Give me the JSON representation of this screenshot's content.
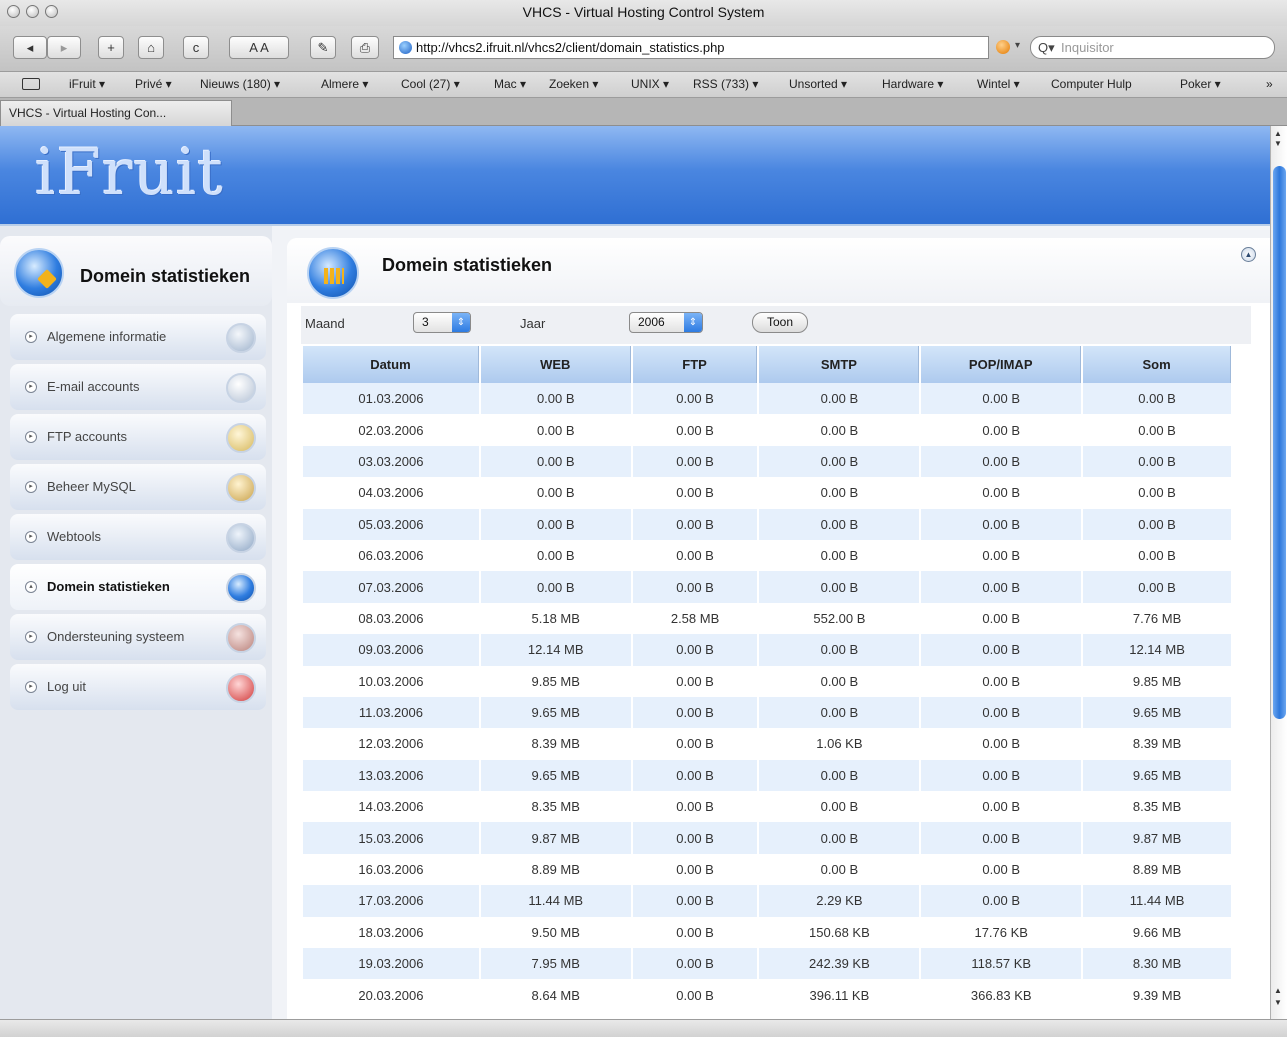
{
  "window": {
    "title": "VHCS - Virtual Hosting Control System"
  },
  "toolbar": {
    "back_label": "◂",
    "forward_label": "▸",
    "add_label": "+",
    "home_label": "⌂",
    "reload_label": "c",
    "text_size_label": "A A",
    "print_label": "⎙",
    "url": "http://vhcs2.ifruit.nl/vhcs2/client/domain_statistics.php",
    "search_placeholder": "Inquisitor"
  },
  "bookmarks": [
    "iFruit ▾",
    "Privé ▾",
    "Nieuws (180) ▾",
    "Almere ▾",
    "Cool (27) ▾",
    "Mac ▾",
    "Zoeken ▾",
    "UNIX ▾",
    "RSS (733) ▾",
    "Unsorted ▾",
    "Hardware ▾",
    "Wintel ▾",
    "Computer Hulp",
    "Poker ▾",
    "»"
  ],
  "tab": {
    "label": "VHCS - Virtual Hosting Con..."
  },
  "banner": {
    "logo_text": "iFruit"
  },
  "sidebar": {
    "title": "Domein statistieken",
    "items": [
      {
        "label": "Algemene informatie",
        "icon": "info-icon"
      },
      {
        "label": "E-mail accounts",
        "icon": "mail-icon"
      },
      {
        "label": "FTP accounts",
        "icon": "folder-icon"
      },
      {
        "label": "Beheer MySQL",
        "icon": "database-icon"
      },
      {
        "label": "Webtools",
        "icon": "tools-icon"
      },
      {
        "label": "Domein statistieken",
        "icon": "statistics-icon",
        "active": true
      },
      {
        "label": "Ondersteuning systeem",
        "icon": "support-icon"
      },
      {
        "label": "Log uit",
        "icon": "logout-icon"
      }
    ]
  },
  "main": {
    "title": "Domein statistieken",
    "filter": {
      "month_label": "Maand",
      "month_value": "3",
      "year_label": "Jaar",
      "year_value": "2006",
      "submit_label": "Toon"
    },
    "table": {
      "headers": [
        "Datum",
        "WEB",
        "FTP",
        "SMTP",
        "POP/IMAP",
        "Som"
      ],
      "rows": [
        [
          "01.03.2006",
          "0.00 B",
          "0.00 B",
          "0.00 B",
          "0.00 B",
          "0.00 B"
        ],
        [
          "02.03.2006",
          "0.00 B",
          "0.00 B",
          "0.00 B",
          "0.00 B",
          "0.00 B"
        ],
        [
          "03.03.2006",
          "0.00 B",
          "0.00 B",
          "0.00 B",
          "0.00 B",
          "0.00 B"
        ],
        [
          "04.03.2006",
          "0.00 B",
          "0.00 B",
          "0.00 B",
          "0.00 B",
          "0.00 B"
        ],
        [
          "05.03.2006",
          "0.00 B",
          "0.00 B",
          "0.00 B",
          "0.00 B",
          "0.00 B"
        ],
        [
          "06.03.2006",
          "0.00 B",
          "0.00 B",
          "0.00 B",
          "0.00 B",
          "0.00 B"
        ],
        [
          "07.03.2006",
          "0.00 B",
          "0.00 B",
          "0.00 B",
          "0.00 B",
          "0.00 B"
        ],
        [
          "08.03.2006",
          "5.18 MB",
          "2.58 MB",
          "552.00 B",
          "0.00 B",
          "7.76 MB"
        ],
        [
          "09.03.2006",
          "12.14 MB",
          "0.00 B",
          "0.00 B",
          "0.00 B",
          "12.14 MB"
        ],
        [
          "10.03.2006",
          "9.85 MB",
          "0.00 B",
          "0.00 B",
          "0.00 B",
          "9.85 MB"
        ],
        [
          "11.03.2006",
          "9.65 MB",
          "0.00 B",
          "0.00 B",
          "0.00 B",
          "9.65 MB"
        ],
        [
          "12.03.2006",
          "8.39 MB",
          "0.00 B",
          "1.06 KB",
          "0.00 B",
          "8.39 MB"
        ],
        [
          "13.03.2006",
          "9.65 MB",
          "0.00 B",
          "0.00 B",
          "0.00 B",
          "9.65 MB"
        ],
        [
          "14.03.2006",
          "8.35 MB",
          "0.00 B",
          "0.00 B",
          "0.00 B",
          "8.35 MB"
        ],
        [
          "15.03.2006",
          "9.87 MB",
          "0.00 B",
          "0.00 B",
          "0.00 B",
          "9.87 MB"
        ],
        [
          "16.03.2006",
          "8.89 MB",
          "0.00 B",
          "0.00 B",
          "0.00 B",
          "8.89 MB"
        ],
        [
          "17.03.2006",
          "11.44 MB",
          "0.00 B",
          "2.29 KB",
          "0.00 B",
          "11.44 MB"
        ],
        [
          "18.03.2006",
          "9.50 MB",
          "0.00 B",
          "150.68 KB",
          "17.76 KB",
          "9.66 MB"
        ],
        [
          "19.03.2006",
          "7.95 MB",
          "0.00 B",
          "242.39 KB",
          "118.57 KB",
          "8.30 MB"
        ],
        [
          "20.03.2006",
          "8.64 MB",
          "0.00 B",
          "396.11 KB",
          "366.83 KB",
          "9.39 MB"
        ]
      ]
    }
  },
  "colors": {
    "banner": "#4a86e0",
    "header_cell": "#aecaee",
    "row_alt": "#e6f0fc",
    "menu_item": "#d7e0ee"
  }
}
